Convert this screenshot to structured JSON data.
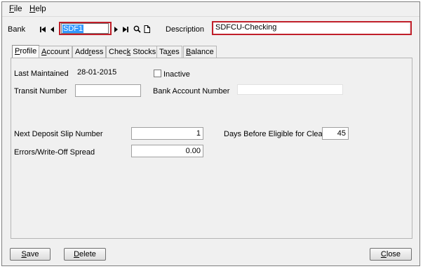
{
  "menu": {
    "file": "File",
    "file_key": "F",
    "file_rest": "ile",
    "help": "Help",
    "help_key": "H",
    "help_rest": "elp"
  },
  "header": {
    "bank_label": "Bank",
    "bank_value": "SDF1",
    "description_label": "Description",
    "description_value": "SDFCU-Checking",
    "icons": [
      "first-record-icon",
      "previous-record-icon",
      "next-record-icon",
      "last-record-icon",
      "search-icon",
      "new-document-icon"
    ]
  },
  "tabs": [
    {
      "key": "P",
      "rest": "rofile"
    },
    {
      "key": "A",
      "pre": "",
      "rest": "ccount"
    },
    {
      "pre": "Add",
      "key": "r",
      "rest": "ess"
    },
    {
      "pre": "Chec",
      "key": "k",
      "rest": " Stocks"
    },
    {
      "pre": "Ta",
      "key": "x",
      "rest": "es"
    },
    {
      "key": "B",
      "rest": "alance"
    }
  ],
  "profile": {
    "last_maintained_label": "Last Maintained",
    "last_maintained_value": "28-01-2015",
    "inactive_label": "Inactive",
    "inactive_checked": false,
    "transit_number_label": "Transit Number",
    "transit_number_value": "",
    "bank_account_number_label": "Bank Account Number",
    "bank_account_number_value": "",
    "next_deposit_label": "Next Deposit Slip Number",
    "next_deposit_value": "1",
    "days_before_label": "Days Before Eligible for Clearing",
    "days_before_value": "45",
    "errors_label": "Errors/Write-Off Spread",
    "errors_value": "0.00"
  },
  "buttons": {
    "save_key": "S",
    "save_rest": "ave",
    "delete_key": "D",
    "delete_rest": "elete",
    "close_key": "C",
    "close_rest": "lose"
  },
  "colors": {
    "highlight_box": "#c01f2a",
    "selection": "#3399ff"
  }
}
